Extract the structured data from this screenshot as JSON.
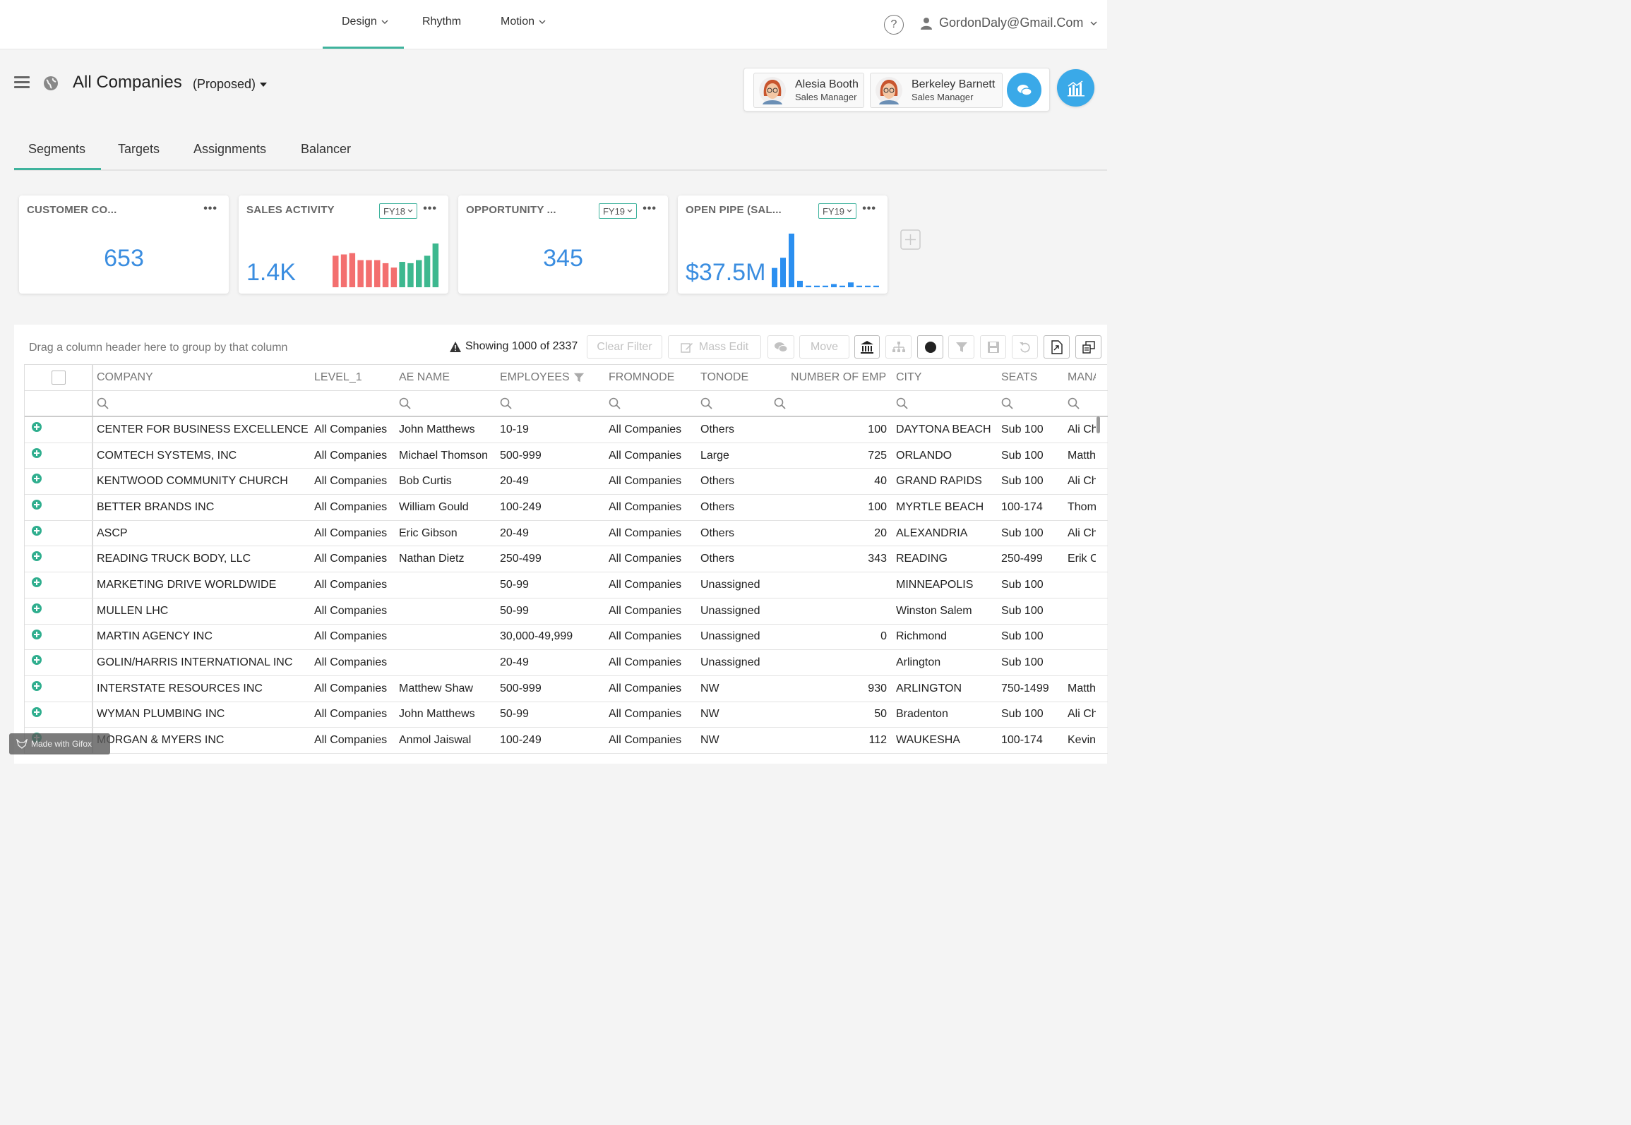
{
  "nav": {
    "items": [
      {
        "label": "Design",
        "dropdown": true
      },
      {
        "label": "Rhythm",
        "dropdown": false
      },
      {
        "label": "Motion",
        "dropdown": true
      }
    ],
    "help_icon": "question-circle-icon",
    "user_email": "GordonDaly@Gmail.Com"
  },
  "header": {
    "title": "All Companies",
    "status": "(Proposed)"
  },
  "managers": [
    {
      "name": "Alesia Booth",
      "role": "Sales Manager"
    },
    {
      "name": "Berkeley Barnett",
      "role": "Sales Manager"
    }
  ],
  "tabs": [
    "Segments",
    "Targets",
    "Assignments",
    "Balancer"
  ],
  "cards": [
    {
      "title": "CUSTOMER CO...",
      "value": "653"
    },
    {
      "title": "SALES ACTIVITY",
      "fy": "FY18",
      "value": "1.4K"
    },
    {
      "title": "OPPORTUNITY ...",
      "fy": "FY19",
      "value": "345"
    },
    {
      "title": "OPEN PIPE (SAL...",
      "fy": "FY19",
      "value": "$37.5M"
    }
  ],
  "sparklines": {
    "sales_activity": {
      "colors": [
        "#f36f6f",
        "#f36f6f",
        "#f36f6f",
        "#f36f6f",
        "#f36f6f",
        "#f36f6f",
        "#f36f6f",
        "#f36f6f",
        "#3db88f",
        "#3db88f",
        "#3db88f",
        "#3db88f",
        "#3db88f"
      ],
      "values": [
        0.72,
        0.75,
        0.78,
        0.62,
        0.62,
        0.62,
        0.55,
        0.45,
        0.58,
        0.55,
        0.62,
        0.72,
        1.0
      ]
    },
    "open_pipe": {
      "color": "#2b8ff0",
      "values": [
        0.36,
        0.55,
        1.0,
        0.12,
        0.03,
        0.03,
        0.03,
        0.06,
        0.03,
        0.09,
        0.03,
        0.03,
        0.03
      ]
    }
  },
  "toolbar": {
    "drag_hint": "Drag a column header here to group by that column",
    "showing": "Showing 1000 of 2337",
    "clear_filter": "Clear Filter",
    "mass_edit": "Mass Edit",
    "move": "Move"
  },
  "table": {
    "columns": [
      "COMPANY",
      "LEVEL_1",
      "AE NAME",
      "EMPLOYEES",
      "FROMNODE",
      "TONODE",
      "NUMBER OF EMP",
      "CITY",
      "SEATS",
      "MANA"
    ],
    "rows": [
      [
        "CENTER FOR BUSINESS EXCELLENCE",
        "All Companies",
        "John Matthews",
        "10-19",
        "All Companies",
        "Others",
        "100",
        "DAYTONA BEACH",
        "Sub 100",
        "Ali Ch"
      ],
      [
        "COMTECH SYSTEMS, INC",
        "All Companies",
        "Michael Thomson",
        "500-999",
        "All Companies",
        "Large",
        "725",
        "ORLANDO",
        "Sub 100",
        "Matth"
      ],
      [
        "KENTWOOD COMMUNITY CHURCH",
        "All Companies",
        "Bob Curtis",
        "20-49",
        "All Companies",
        "Others",
        "40",
        "GRAND RAPIDS",
        "Sub 100",
        "Ali Ch"
      ],
      [
        "BETTER BRANDS INC",
        "All Companies",
        "William Gould",
        "100-249",
        "All Companies",
        "Others",
        "100",
        "MYRTLE BEACH",
        "100-174",
        "Thom"
      ],
      [
        "ASCP",
        "All Companies",
        "Eric Gibson",
        "20-49",
        "All Companies",
        "Others",
        "20",
        "ALEXANDRIA",
        "Sub 100",
        "Ali Ch"
      ],
      [
        "READING TRUCK BODY, LLC",
        "All Companies",
        "Nathan Dietz",
        "250-499",
        "All Companies",
        "Others",
        "343",
        "READING",
        "250-499",
        "Erik C"
      ],
      [
        "MARKETING DRIVE WORLDWIDE",
        "All Companies",
        "",
        "50-99",
        "All Companies",
        "Unassigned",
        "",
        "MINNEAPOLIS",
        "Sub 100",
        ""
      ],
      [
        "MULLEN LHC",
        "All Companies",
        "",
        "50-99",
        "All Companies",
        "Unassigned",
        "",
        "Winston Salem",
        "Sub 100",
        ""
      ],
      [
        "MARTIN AGENCY INC",
        "All Companies",
        "",
        "30,000-49,999",
        "All Companies",
        "Unassigned",
        "0",
        "Richmond",
        "Sub 100",
        ""
      ],
      [
        "GOLIN/HARRIS INTERNATIONAL INC",
        "All Companies",
        "",
        "20-49",
        "All Companies",
        "Unassigned",
        "",
        "Arlington",
        "Sub 100",
        ""
      ],
      [
        "INTERSTATE RESOURCES INC",
        "All Companies",
        "Matthew Shaw",
        "500-999",
        "All Companies",
        "NW",
        "930",
        "ARLINGTON",
        "750-1499",
        "Matth"
      ],
      [
        "WYMAN PLUMBING INC",
        "All Companies",
        "John Matthews",
        "50-99",
        "All Companies",
        "NW",
        "50",
        "Bradenton",
        "Sub 100",
        "Ali Ch"
      ],
      [
        "MORGAN & MYERS INC",
        "All Companies",
        "Anmol Jaiswal",
        "100-249",
        "All Companies",
        "NW",
        "112",
        "WAUKESHA",
        "100-174",
        "Kevin"
      ]
    ]
  },
  "watermark": "Made with Gifox"
}
